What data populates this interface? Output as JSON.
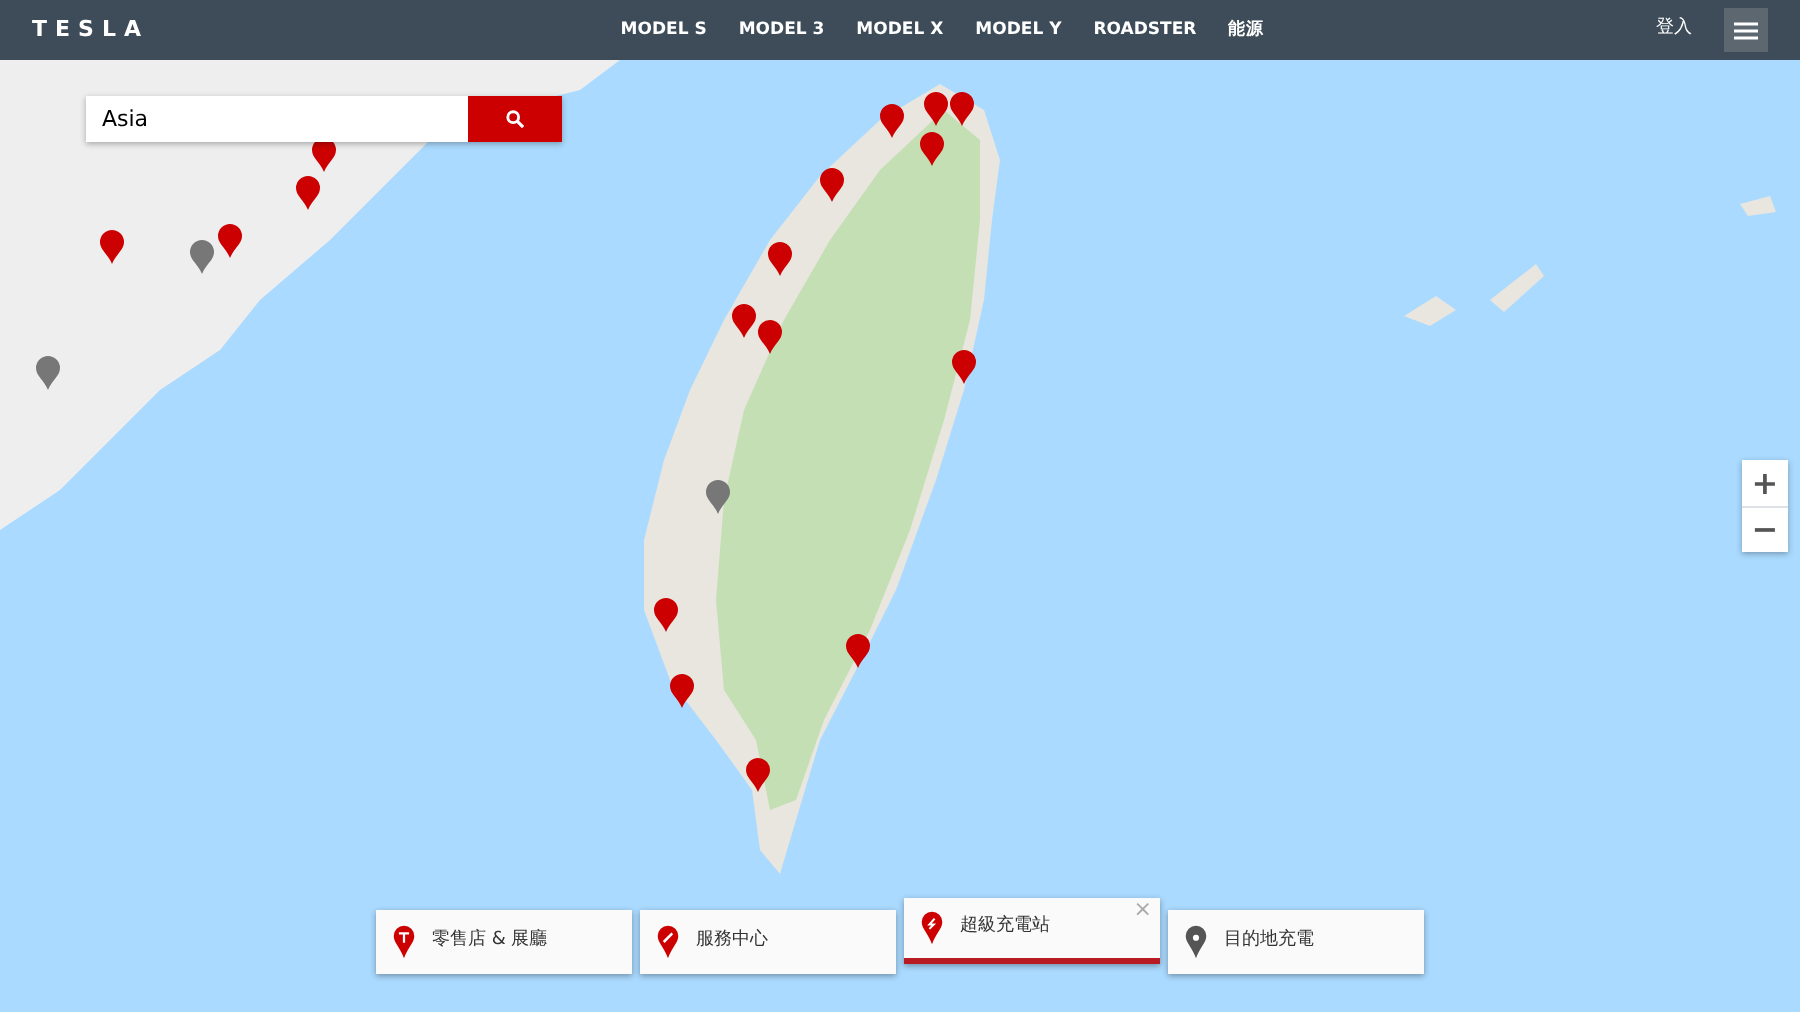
{
  "header": {
    "logo": "TESLA",
    "nav": [
      "MODEL S",
      "MODEL 3",
      "MODEL X",
      "MODEL Y",
      "ROADSTER",
      "能源"
    ],
    "sign_in": "登入"
  },
  "search": {
    "value": "Asia"
  },
  "zoom": {
    "zoom_in": "+",
    "zoom_out": "−"
  },
  "legend": [
    {
      "label": "零售店 & 展廳",
      "kind": "store",
      "selected": false
    },
    {
      "label": "服務中心",
      "kind": "service",
      "selected": false
    },
    {
      "label": "超級充電站",
      "kind": "supercharger",
      "selected": true
    },
    {
      "label": "目的地充電",
      "kind": "destination",
      "selected": false
    }
  ],
  "legend_close": "×"
}
